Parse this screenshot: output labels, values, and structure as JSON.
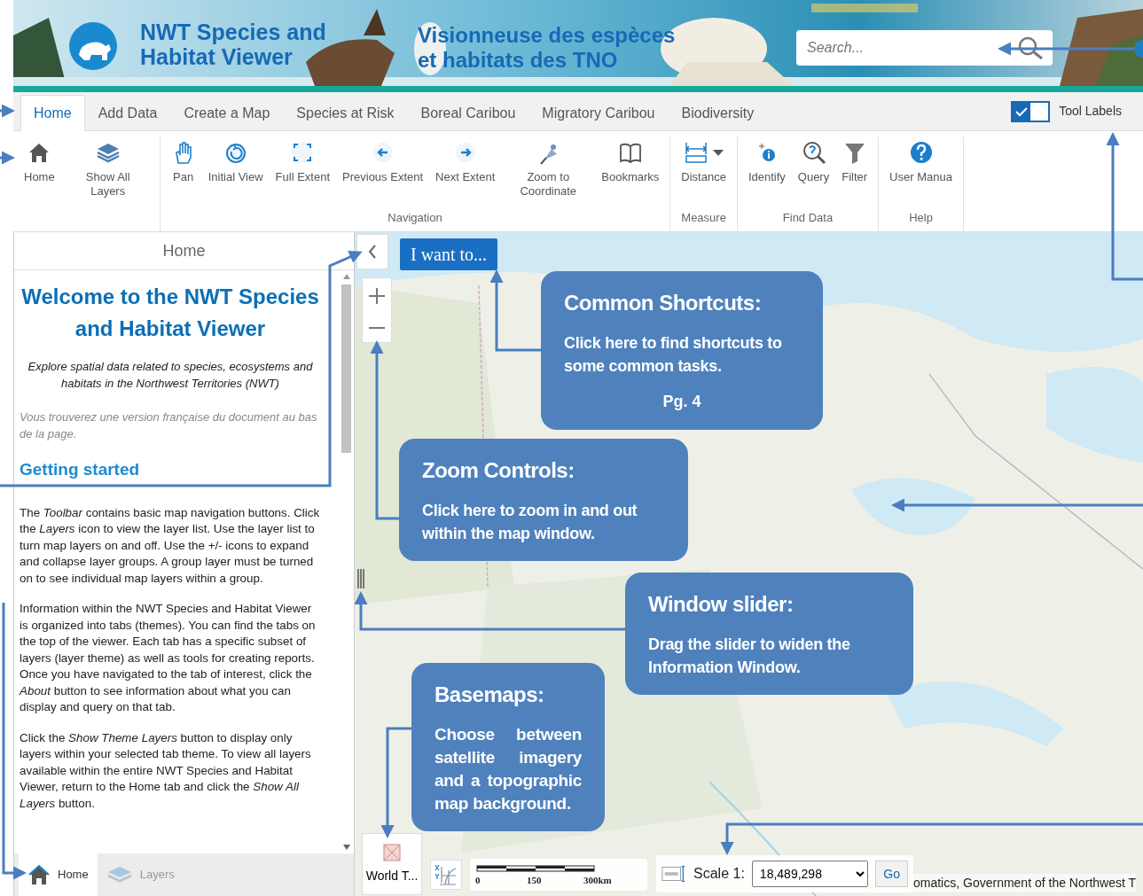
{
  "header": {
    "title_en": [
      "NWT Species and",
      "Habitat Viewer"
    ],
    "title_fr": [
      "Visionneuse des espèces",
      "et habitats des TNO"
    ],
    "search": {
      "placeholder": "Search..."
    }
  },
  "tabs": [
    {
      "label": "Home",
      "selected": true
    },
    {
      "label": "Add Data",
      "selected": false
    },
    {
      "label": "Create a Map",
      "selected": false
    },
    {
      "label": "Species at Risk",
      "selected": false
    },
    {
      "label": "Boreal Caribou",
      "selected": false
    },
    {
      "label": "Migratory Caribou",
      "selected": false
    },
    {
      "label": "Biodiversity",
      "selected": false
    }
  ],
  "tool_labels": {
    "label": "Tool Labels",
    "on": true
  },
  "toolbar": [
    {
      "tools": [
        {
          "label": "Home"
        },
        {
          "label": "Show All Layers"
        }
      ]
    },
    {
      "title": "Navigation",
      "tools": [
        {
          "label": "Pan"
        },
        {
          "label": "Initial View"
        },
        {
          "label": "Full Extent"
        },
        {
          "label": "Previous Extent"
        },
        {
          "label": "Next Extent"
        },
        {
          "label": "Zoom to Coordinate"
        },
        {
          "label": "Bookmarks"
        }
      ]
    },
    {
      "title": "Measure",
      "tools": [
        {
          "label": "Distance",
          "has_menu": true
        }
      ]
    },
    {
      "title": "Find Data",
      "tools": [
        {
          "label": "Identify"
        },
        {
          "label": "Query"
        },
        {
          "label": "Filter"
        }
      ]
    },
    {
      "title": "Help",
      "tools": [
        {
          "label": "User Manua"
        }
      ]
    }
  ],
  "panel": {
    "header": "Home",
    "title": "Welcome to the NWT Species and Habitat Viewer",
    "subtitle": "Explore spatial data related to species, ecosystems and habitats in the Northwest Territories (NWT)",
    "french_note": "Vous trouverez une version française du document au bas de la page.",
    "heading": "Getting started",
    "paragraphs": [
      "The *Toolbar* contains basic map navigation buttons. Click the *Layers* icon to view the layer list. Use the layer list to turn map layers on and off. Use the +/- icons to expand and collapse layer groups. A group layer must be turned on to see individual map layers within a group.",
      "Information within the NWT Species and Habitat Viewer is organized into tabs (themes). You can find the tabs on the top of the viewer. Each tab has a specific subset of layers (layer theme) as well as tools for creating reports. Once you have navigated to the tab of interest, click the *About* button to see information about what you can display and query on that tab.",
      "Click the *Show Theme Layers* button to display only layers within your selected tab theme. To view all layers available within the entire NWT Species and Habitat Viewer, return to the Home tab and click the *Show All Layers* button."
    ],
    "bottom_tabs": [
      {
        "label": "Home",
        "selected": true
      },
      {
        "label": "Layers",
        "selected": false
      }
    ]
  },
  "map": {
    "i_want_to": "I want to...",
    "basemap": "World T...",
    "scale_bar": [
      "0",
      "150",
      "300km"
    ],
    "scale_label": "Scale 1:",
    "scale_value": "18,489,298",
    "go": "Go",
    "attribution": "omatics, Government of the Northwest T"
  },
  "callouts": [
    {
      "title": "Common Shortcuts:",
      "body": "Click here to find shortcuts to some common tasks.",
      "page": "Pg. 4"
    },
    {
      "title": "Zoom Controls:",
      "body": "Click here to zoom in and out within the map window."
    },
    {
      "title": "Window slider:",
      "body": "Drag the slider to widen the Information Window."
    },
    {
      "title": "Basemaps:",
      "body": "Choose between satellite imagery and a topographic map background."
    }
  ]
}
